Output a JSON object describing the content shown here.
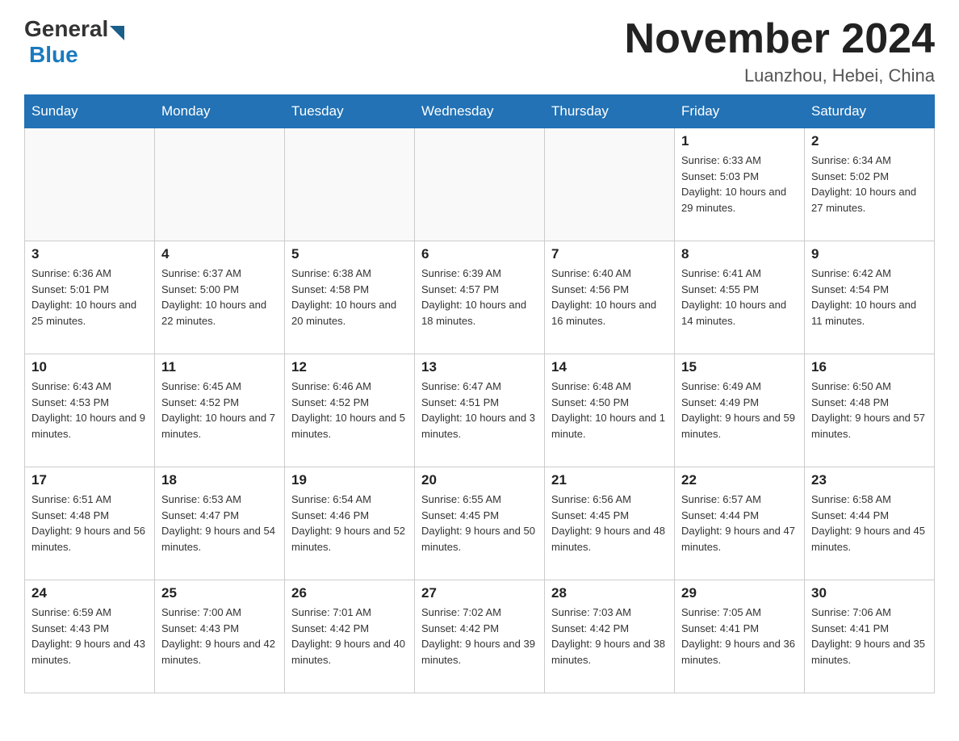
{
  "header": {
    "logo_general": "General",
    "logo_blue": "Blue",
    "title": "November 2024",
    "subtitle": "Luanzhou, Hebei, China"
  },
  "weekdays": [
    "Sunday",
    "Monday",
    "Tuesday",
    "Wednesday",
    "Thursday",
    "Friday",
    "Saturday"
  ],
  "weeks": [
    [
      {
        "day": "",
        "info": ""
      },
      {
        "day": "",
        "info": ""
      },
      {
        "day": "",
        "info": ""
      },
      {
        "day": "",
        "info": ""
      },
      {
        "day": "",
        "info": ""
      },
      {
        "day": "1",
        "info": "Sunrise: 6:33 AM\nSunset: 5:03 PM\nDaylight: 10 hours and 29 minutes."
      },
      {
        "day": "2",
        "info": "Sunrise: 6:34 AM\nSunset: 5:02 PM\nDaylight: 10 hours and 27 minutes."
      }
    ],
    [
      {
        "day": "3",
        "info": "Sunrise: 6:36 AM\nSunset: 5:01 PM\nDaylight: 10 hours and 25 minutes."
      },
      {
        "day": "4",
        "info": "Sunrise: 6:37 AM\nSunset: 5:00 PM\nDaylight: 10 hours and 22 minutes."
      },
      {
        "day": "5",
        "info": "Sunrise: 6:38 AM\nSunset: 4:58 PM\nDaylight: 10 hours and 20 minutes."
      },
      {
        "day": "6",
        "info": "Sunrise: 6:39 AM\nSunset: 4:57 PM\nDaylight: 10 hours and 18 minutes."
      },
      {
        "day": "7",
        "info": "Sunrise: 6:40 AM\nSunset: 4:56 PM\nDaylight: 10 hours and 16 minutes."
      },
      {
        "day": "8",
        "info": "Sunrise: 6:41 AM\nSunset: 4:55 PM\nDaylight: 10 hours and 14 minutes."
      },
      {
        "day": "9",
        "info": "Sunrise: 6:42 AM\nSunset: 4:54 PM\nDaylight: 10 hours and 11 minutes."
      }
    ],
    [
      {
        "day": "10",
        "info": "Sunrise: 6:43 AM\nSunset: 4:53 PM\nDaylight: 10 hours and 9 minutes."
      },
      {
        "day": "11",
        "info": "Sunrise: 6:45 AM\nSunset: 4:52 PM\nDaylight: 10 hours and 7 minutes."
      },
      {
        "day": "12",
        "info": "Sunrise: 6:46 AM\nSunset: 4:52 PM\nDaylight: 10 hours and 5 minutes."
      },
      {
        "day": "13",
        "info": "Sunrise: 6:47 AM\nSunset: 4:51 PM\nDaylight: 10 hours and 3 minutes."
      },
      {
        "day": "14",
        "info": "Sunrise: 6:48 AM\nSunset: 4:50 PM\nDaylight: 10 hours and 1 minute."
      },
      {
        "day": "15",
        "info": "Sunrise: 6:49 AM\nSunset: 4:49 PM\nDaylight: 9 hours and 59 minutes."
      },
      {
        "day": "16",
        "info": "Sunrise: 6:50 AM\nSunset: 4:48 PM\nDaylight: 9 hours and 57 minutes."
      }
    ],
    [
      {
        "day": "17",
        "info": "Sunrise: 6:51 AM\nSunset: 4:48 PM\nDaylight: 9 hours and 56 minutes."
      },
      {
        "day": "18",
        "info": "Sunrise: 6:53 AM\nSunset: 4:47 PM\nDaylight: 9 hours and 54 minutes."
      },
      {
        "day": "19",
        "info": "Sunrise: 6:54 AM\nSunset: 4:46 PM\nDaylight: 9 hours and 52 minutes."
      },
      {
        "day": "20",
        "info": "Sunrise: 6:55 AM\nSunset: 4:45 PM\nDaylight: 9 hours and 50 minutes."
      },
      {
        "day": "21",
        "info": "Sunrise: 6:56 AM\nSunset: 4:45 PM\nDaylight: 9 hours and 48 minutes."
      },
      {
        "day": "22",
        "info": "Sunrise: 6:57 AM\nSunset: 4:44 PM\nDaylight: 9 hours and 47 minutes."
      },
      {
        "day": "23",
        "info": "Sunrise: 6:58 AM\nSunset: 4:44 PM\nDaylight: 9 hours and 45 minutes."
      }
    ],
    [
      {
        "day": "24",
        "info": "Sunrise: 6:59 AM\nSunset: 4:43 PM\nDaylight: 9 hours and 43 minutes."
      },
      {
        "day": "25",
        "info": "Sunrise: 7:00 AM\nSunset: 4:43 PM\nDaylight: 9 hours and 42 minutes."
      },
      {
        "day": "26",
        "info": "Sunrise: 7:01 AM\nSunset: 4:42 PM\nDaylight: 9 hours and 40 minutes."
      },
      {
        "day": "27",
        "info": "Sunrise: 7:02 AM\nSunset: 4:42 PM\nDaylight: 9 hours and 39 minutes."
      },
      {
        "day": "28",
        "info": "Sunrise: 7:03 AM\nSunset: 4:42 PM\nDaylight: 9 hours and 38 minutes."
      },
      {
        "day": "29",
        "info": "Sunrise: 7:05 AM\nSunset: 4:41 PM\nDaylight: 9 hours and 36 minutes."
      },
      {
        "day": "30",
        "info": "Sunrise: 7:06 AM\nSunset: 4:41 PM\nDaylight: 9 hours and 35 minutes."
      }
    ]
  ]
}
